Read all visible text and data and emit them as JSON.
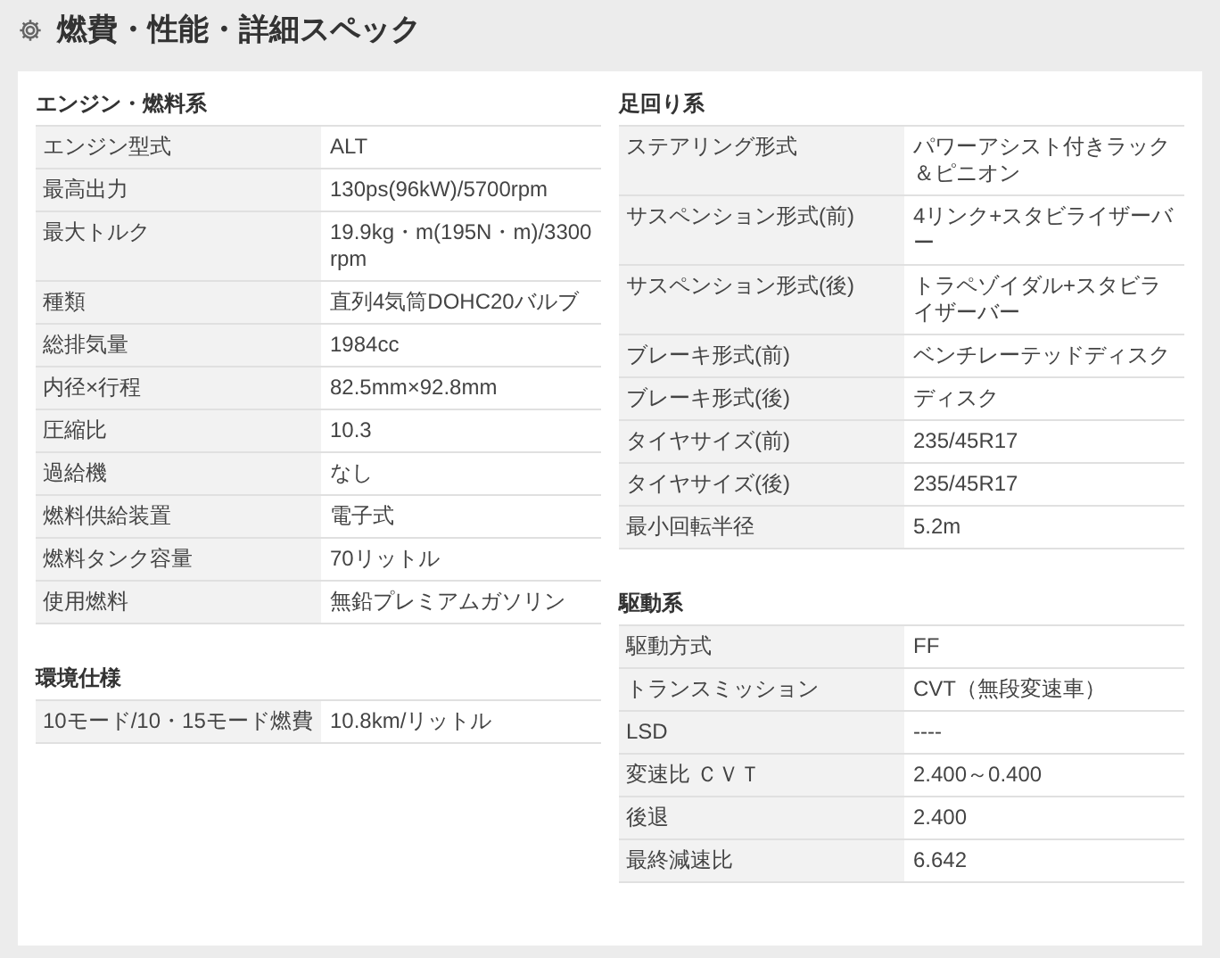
{
  "title": "燃費・性能・詳細スペック",
  "columns": [
    {
      "sections": [
        {
          "heading": "エンジン・燃料系",
          "rows": [
            {
              "label": "エンジン型式",
              "value": "ALT"
            },
            {
              "label": "最高出力",
              "value": "130ps(96kW)/5700rpm"
            },
            {
              "label": "最大トルク",
              "value": "19.9kg・m(195N・m)/3300rpm"
            },
            {
              "label": "種類",
              "value": "直列4気筒DOHC20バルブ"
            },
            {
              "label": "総排気量",
              "value": "1984cc"
            },
            {
              "label": "内径×行程",
              "value": "82.5mm×92.8mm"
            },
            {
              "label": "圧縮比",
              "value": "10.3"
            },
            {
              "label": "過給機",
              "value": "なし"
            },
            {
              "label": "燃料供給装置",
              "value": "電子式"
            },
            {
              "label": "燃料タンク容量",
              "value": "70リットル"
            },
            {
              "label": "使用燃料",
              "value": "無鉛プレミアムガソリン"
            }
          ]
        },
        {
          "heading": "環境仕様",
          "rows": [
            {
              "label": "10モード/10・15モード燃費",
              "value": "10.8km/リットル"
            }
          ]
        }
      ]
    },
    {
      "sections": [
        {
          "heading": "足回り系",
          "rows": [
            {
              "label": "ステアリング形式",
              "value": "パワーアシスト付きラック＆ピニオン"
            },
            {
              "label": "サスペンション形式(前)",
              "value": "4リンク+スタビライザーバー"
            },
            {
              "label": "サスペンション形式(後)",
              "value": "トラペゾイダル+スタビライザーバー"
            },
            {
              "label": "ブレーキ形式(前)",
              "value": "ベンチレーテッドディスク"
            },
            {
              "label": "ブレーキ形式(後)",
              "value": "ディスク"
            },
            {
              "label": "タイヤサイズ(前)",
              "value": "235/45R17"
            },
            {
              "label": "タイヤサイズ(後)",
              "value": "235/45R17"
            },
            {
              "label": "最小回転半径",
              "value": "5.2m"
            }
          ]
        },
        {
          "heading": "駆動系",
          "rows": [
            {
              "label": "駆動方式",
              "value": "FF"
            },
            {
              "label": "トランスミッション",
              "value": "CVT（無段変速車）"
            },
            {
              "label": "LSD",
              "value": "----"
            },
            {
              "label": "変速比 ＣＶＴ",
              "value": "2.400～0.400"
            },
            {
              "label": "後退",
              "value": "2.400"
            },
            {
              "label": "最終減速比",
              "value": "6.642"
            }
          ]
        }
      ]
    }
  ]
}
